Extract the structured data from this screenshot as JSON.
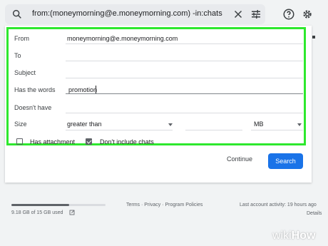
{
  "search": {
    "query": "from:(moneymorning@e.moneymorning.com) -in:chats"
  },
  "form": {
    "from": {
      "label": "From",
      "value": "moneymorning@e.moneymorning.com"
    },
    "to": {
      "label": "To",
      "value": ""
    },
    "subject": {
      "label": "Subject",
      "value": ""
    },
    "has_words": {
      "label": "Has the words",
      "value": "promotion"
    },
    "doesnt_have": {
      "label": "Doesn't have",
      "value": ""
    },
    "size": {
      "label": "Size",
      "operator": "greater than",
      "amount": "",
      "unit": "MB"
    },
    "has_attachment": {
      "label": "Has attachment",
      "checked": false
    },
    "dont_include_chats": {
      "label": "Don't include chats",
      "checked": true
    }
  },
  "actions": {
    "continue_label": "Continue",
    "search_label": "Search"
  },
  "footer": {
    "storage_text": "9.18 GB of 15 GB used",
    "storage_fraction": 0.61,
    "links": "Terms · Privacy · Program Policies",
    "activity": "Last account activity: 19 hours ago",
    "details": "Details"
  },
  "watermark": {
    "part1": "wiki",
    "part2": "How"
  },
  "colors": {
    "highlight": "#2ee82e",
    "primary": "#1a73e8"
  }
}
